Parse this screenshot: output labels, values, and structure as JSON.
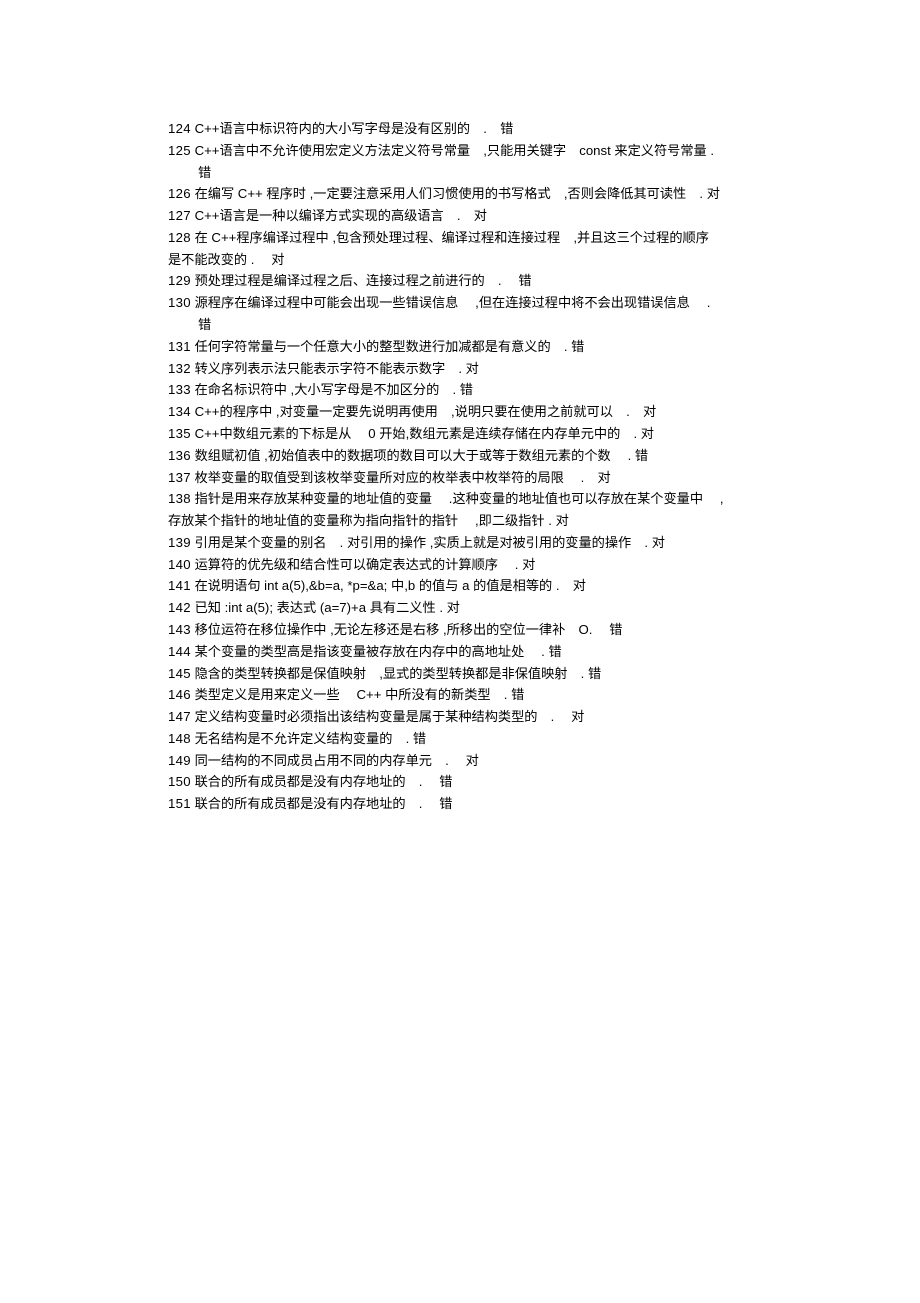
{
  "lines": [
    {
      "type": "normal",
      "num": "124",
      "text": "C++语言中标识符内的大小写字母是没有区别的 . 错"
    },
    {
      "type": "normal",
      "num": "125",
      "text": "C++语言中不允许使用宏定义方法定义符号常量 ,只能用关键字 const 来定义符号常量  ."
    },
    {
      "type": "indent",
      "text": "错"
    },
    {
      "type": "normal",
      "num": "126",
      "text": "在编写  C++ 程序时 ,一定要注意采用人们习惯使用的书写格式 ,否则会降低其可读性 . 对"
    },
    {
      "type": "normal",
      "num": "127",
      "text": "C++语言是一种以编译方式实现的高级语言 . 对"
    },
    {
      "type": "normal",
      "num": "128",
      "text": "在 C++程序编译过程中  ,包含预处理过程、编译过程和连接过程 ,并且这三个过程的顺序"
    },
    {
      "type": "flushLeft",
      "text": "是不能改变的  .  对"
    },
    {
      "type": "normal",
      "num": "129",
      "text": "预处理过程是编译过程之后、连接过程之前进行的 .  错"
    },
    {
      "type": "normal",
      "num": "130",
      "text": "源程序在编译过程中可能会出现一些错误信息  ,但在连接过程中将不会出现错误信息  ."
    },
    {
      "type": "indent",
      "text": "错"
    },
    {
      "type": "normal",
      "num": "131",
      "text": "任何字符常量与一个任意大小的整型数进行加减都是有意义的 .  错"
    },
    {
      "type": "normal",
      "num": "132",
      "text": "转义序列表示法只能表示字符不能表示数字 .  对"
    },
    {
      "type": "normal",
      "num": "133",
      "text": "在命名标识符中  ,大小写字母是不加区分的 .   错"
    },
    {
      "type": "normal",
      "num": "134",
      "text": "C++的程序中  ,对变量一定要先说明再使用 ,说明只要在使用之前就可以 . 对"
    },
    {
      "type": "normal",
      "num": "135",
      "text": "C++中数组元素的下标是从  0 开始,数组元素是连续存储在内存单元中的 .   对"
    },
    {
      "type": "normal",
      "num": "136",
      "text": "数组赋初值  ,初始值表中的数据项的数目可以大于或等于数组元素的个数  .  错"
    },
    {
      "type": "normal",
      "num": "137",
      "text": "枚举变量的取值受到该枚举变量所对应的枚举表中枚举符的局限  . 对"
    },
    {
      "type": "normal",
      "num": "138",
      "text": "指针是用来存放某种变量的地址值的变量  .这种变量的地址值也可以存放在某个变量中  ,"
    },
    {
      "type": "flushLeft",
      "text": "存放某个指针的地址值的变量称为指向指针的指针  ,即二级指针  . 对"
    },
    {
      "type": "normal",
      "num": "139",
      "text": "引用是某个变量的别名 . 对引用的操作  ,实质上就是对被引用的变量的操作 . 对"
    },
    {
      "type": "normal",
      "num": "140",
      "text": "运算符的优先级和结合性可以确定表达式的计算顺序  .  对"
    },
    {
      "type": "normal",
      "num": "141",
      "text": "在说明语句   int a(5),&b=a, *p=&a;  中,b 的值与  a 的值是相等的  . 对"
    },
    {
      "type": "normal",
      "num": "142",
      "text": "已知 :int a(5); 表达式 (a=7)+a  具有二义性  .  对"
    },
    {
      "type": "normal",
      "num": "143",
      "text": "移位运符在移位操作中   ,无论左移还是右移   ,所移出的空位一律补 O.  错"
    },
    {
      "type": "normal",
      "num": "144",
      "text": "某个变量的类型高是指该变量被存放在内存中的高地址处  .  错"
    },
    {
      "type": "normal",
      "num": "145",
      "text": "隐含的类型转换都是保值映射 ,显式的类型转换都是非保值映射 . 错"
    },
    {
      "type": "normal",
      "num": "146",
      "text": "类型定义是用来定义一些  C++ 中所没有的新类型 .  错"
    },
    {
      "type": "normal",
      "num": "147",
      "text": "定义结构变量时必须指出该结构变量是属于某种结构类型的 .  对"
    },
    {
      "type": "normal",
      "num": "148",
      "text": "无名结构是不允许定义结构变量的 .  错"
    },
    {
      "type": "normal",
      "num": "149",
      "text": "同一结构的不同成员占用不同的内存单元 .  对"
    },
    {
      "type": "normal",
      "num": "150",
      "text": "联合的所有成员都是没有内存地址的 .  错"
    },
    {
      "type": "normal",
      "num": "151",
      "text": "联合的所有成员都是没有内存地址的 .  错"
    }
  ]
}
